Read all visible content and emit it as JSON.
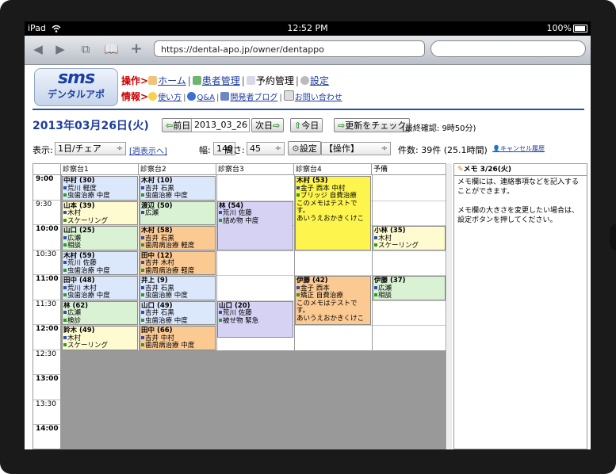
{
  "status_bar": {
    "device": "iPad",
    "time": "12:52 PM",
    "battery": "100%"
  },
  "browser": {
    "url": "https://dental-apo.jp/owner/dentappo"
  },
  "logo": {
    "line1": "sms",
    "line2": "デンタルアポ"
  },
  "menu": {
    "ops_label": "操作>",
    "ops": [
      "ホーム",
      "患者管理",
      "予約管理",
      "設定"
    ],
    "info_label": "情報>",
    "info": [
      "使い方",
      "Q&A",
      "開発者ブログ",
      "お問い合わせ"
    ]
  },
  "date_bar": {
    "date": "2013年03月26日(火)",
    "prev": "前日",
    "date_input": "2013_03_26",
    "next": "次日",
    "today": "今日",
    "refresh": "更新をチェック",
    "last_confirm": "(最終確認: 9時50分)"
  },
  "toolbar": {
    "display_label": "表示:",
    "display_value": "1日/チェア",
    "week_link": "[週表示へ]",
    "width_label": "幅:",
    "width_value": "140",
    "height_label": "高さ:",
    "height_value": "45",
    "settings": "設定",
    "ops_select": "【操作】",
    "count": "件数: 39件 (25.1時間)",
    "cancel_history": "キャンセル履歴"
  },
  "schedule": {
    "columns": [
      "診察台1",
      "診察台2",
      "診察台3",
      "診察台4",
      "予備"
    ],
    "times": [
      "9:00",
      "9:30",
      "10:00",
      "10:30",
      "11:00",
      "11:30",
      "12:00",
      "12:30",
      "13:00",
      "13:30",
      "14:00"
    ],
    "appointments": [
      {
        "col": 0,
        "row": 0,
        "span": 1,
        "color": "blue",
        "name": "中村 (30)",
        "lines": [
          "荒川 軽度",
          "虫歯治療 中度"
        ]
      },
      {
        "col": 0,
        "row": 1,
        "span": 1,
        "color": "yellow",
        "name": "山本 (39)",
        "lines": [
          "木村",
          "スケーリング"
        ]
      },
      {
        "col": 0,
        "row": 2,
        "span": 1,
        "color": "green",
        "name": "山口 (25)",
        "lines": [
          "広瀬",
          "相談"
        ]
      },
      {
        "col": 0,
        "row": 3,
        "span": 1,
        "color": "blue",
        "name": "木村 (59)",
        "lines": [
          "荒川 佐藤",
          "虫歯治療 中度"
        ]
      },
      {
        "col": 0,
        "row": 4,
        "span": 1,
        "color": "blue",
        "name": "田中 (48)",
        "lines": [
          "荒川 木村",
          "虫歯治療 中度"
        ]
      },
      {
        "col": 0,
        "row": 5,
        "span": 1,
        "color": "green",
        "name": "林 (62)",
        "lines": [
          "広瀬",
          "検診"
        ]
      },
      {
        "col": 0,
        "row": 6,
        "span": 1,
        "color": "yellow",
        "name": "鈴木 (49)",
        "lines": [
          "木村",
          "スケーリング"
        ]
      },
      {
        "col": 1,
        "row": 0,
        "span": 1,
        "color": "blue",
        "name": "木村 (10)",
        "lines": [
          "吉井 石黒",
          "虫歯治療 中度"
        ]
      },
      {
        "col": 1,
        "row": 1,
        "span": 1,
        "color": "green",
        "name": "渡辺 (50)",
        "lines": [
          "広瀬"
        ]
      },
      {
        "col": 1,
        "row": 2,
        "span": 1,
        "color": "orange",
        "name": "木村 (58)",
        "lines": [
          "吉井 石黒",
          "歯周病治療 軽度"
        ]
      },
      {
        "col": 1,
        "row": 3,
        "span": 1,
        "color": "orange",
        "name": "田中 (12)",
        "lines": [
          "吉井 木村",
          "歯周病治療 軽度"
        ]
      },
      {
        "col": 1,
        "row": 4,
        "span": 1,
        "color": "blue",
        "name": "井上 (9)",
        "lines": [
          "吉井 石黒",
          "虫歯治療 中度"
        ]
      },
      {
        "col": 1,
        "row": 5,
        "span": 1,
        "color": "blue",
        "name": "山口 (49)",
        "lines": [
          "吉井 石黒",
          "虫歯治療 中度"
        ]
      },
      {
        "col": 1,
        "row": 6,
        "span": 1,
        "color": "orange",
        "name": "田中 (66)",
        "lines": [
          "吉井 中村",
          "歯周病治療 中度"
        ]
      },
      {
        "col": 2,
        "row": 1,
        "span": 2,
        "color": "purple",
        "name": "林 (54)",
        "lines": [
          "荒川 佐藤",
          "詰め物 中度"
        ]
      },
      {
        "col": 2,
        "row": 5,
        "span": 1.5,
        "color": "purple",
        "name": "山口 (20)",
        "lines": [
          "荒川 佐藤",
          "被せ物 緊急"
        ]
      },
      {
        "col": 3,
        "row": 0,
        "span": 3,
        "color": "gold",
        "name": "木村 (53)",
        "lines": [
          "金子 西本 中村",
          "ブリッジ 自費治療",
          "このメモはテストです。",
          "あいうえおかきくけこ"
        ]
      },
      {
        "col": 3,
        "row": 4,
        "span": 2,
        "color": "orange",
        "name": "伊藤 (42)",
        "lines": [
          "金子 西本",
          "矯正 自費治療",
          "このメモはテストです。",
          "あいうえおかきくけこ"
        ]
      },
      {
        "col": 4,
        "row": 2,
        "span": 1,
        "color": "yellow",
        "name": "小林 (35)",
        "lines": [
          "木村",
          "スケーリング"
        ]
      },
      {
        "col": 4,
        "row": 4,
        "span": 1,
        "color": "green",
        "name": "伊藤 (37)",
        "lines": [
          "広瀬",
          "相談"
        ]
      }
    ]
  },
  "memo": {
    "title": "メモ 3/26(火)",
    "text1": "メモ欄には、連絡事項などを記入することができます。",
    "text2": "メモ欄の大きさを変更したい場合は、設定ボタンを押してください。"
  },
  "colors": {
    "accent": "#1f3d9e",
    "menu_red": "#cc0000"
  }
}
